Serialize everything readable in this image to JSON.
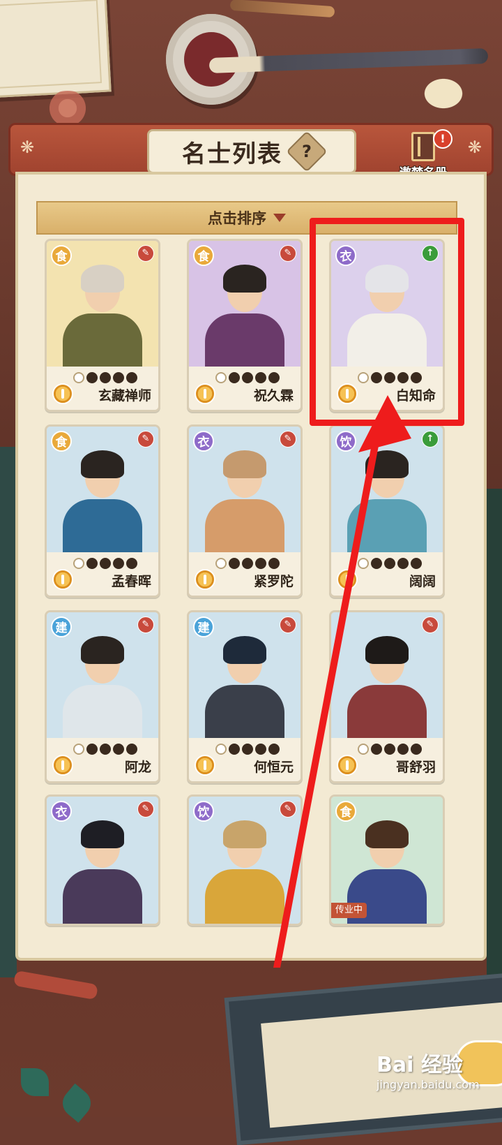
{
  "header": {
    "title": "名士列表",
    "help_symbol": "?",
    "album_label": "遨梦名册",
    "album_badge": "!"
  },
  "sort": {
    "label": "点击排序"
  },
  "cards": [
    {
      "name": "玄藏禅师",
      "category": "食",
      "category_color": "#e9a93a",
      "bg": "#f3e3b0",
      "corner": "✎",
      "corner_color": "#c84a3c",
      "hair": "#d8d0c4",
      "robe": "#6a6a3a",
      "stars_filled": 4
    },
    {
      "name": "祝久霖",
      "category": "食",
      "category_color": "#e9a93a",
      "bg": "#d8c3e6",
      "corner": "✎",
      "corner_color": "#c84a3c",
      "hair": "#2a2420",
      "robe": "#6a3a6a",
      "stars_filled": 4
    },
    {
      "name": "白知命",
      "category": "衣",
      "category_color": "#8e6bc9",
      "bg": "#dcd0ec",
      "corner": "↑",
      "corner_color": "#3a9c3a",
      "hair": "#e4e4e8",
      "robe": "#f2efe8",
      "stars_filled": 4
    },
    {
      "name": "孟春晖",
      "category": "食",
      "category_color": "#e9a93a",
      "bg": "#cfe2ec",
      "corner": "✎",
      "corner_color": "#c84a3c",
      "hair": "#2a2420",
      "robe": "#2e6b96",
      "stars_filled": 4
    },
    {
      "name": "紧罗陀",
      "category": "衣",
      "category_color": "#8e6bc9",
      "bg": "#cfe2ec",
      "corner": "✎",
      "corner_color": "#c84a3c",
      "hair": "#c59a6e",
      "robe": "#d69c6a",
      "stars_filled": 4
    },
    {
      "name": "阔阔",
      "category": "饮",
      "category_color": "#8e6bc9",
      "bg": "#cfe2ec",
      "corner": "↑",
      "corner_color": "#3a9c3a",
      "hair": "#2a2420",
      "robe": "#5aa0b4",
      "stars_filled": 4
    },
    {
      "name": "阿龙",
      "category": "建",
      "category_color": "#4aa3d9",
      "bg": "#cfe2ec",
      "corner": "✎",
      "corner_color": "#c84a3c",
      "hair": "#2a2420",
      "robe": "#dfe6ea",
      "stars_filled": 4
    },
    {
      "name": "何恒元",
      "category": "建",
      "category_color": "#4aa3d9",
      "bg": "#cfe2ec",
      "corner": "✎",
      "corner_color": "#c84a3c",
      "hair": "#1e2a3a",
      "robe": "#3a3f4a",
      "stars_filled": 4
    },
    {
      "name": "哥舒羽",
      "category": "",
      "category_color": "#4aa3d9",
      "bg": "#cfe2ec",
      "corner": "✎",
      "corner_color": "#c84a3c",
      "hair": "#1e1a18",
      "robe": "#8a3a3a",
      "stars_filled": 4
    },
    {
      "name": "",
      "category": "衣",
      "category_color": "#8e6bc9",
      "bg": "#cfe2ec",
      "corner": "✎",
      "corner_color": "#c84a3c",
      "hair": "#1e1e24",
      "robe": "#4a3a5a",
      "stars_filled": 4
    },
    {
      "name": "",
      "category": "饮",
      "category_color": "#8e6bc9",
      "bg": "#cfe2ec",
      "corner": "✎",
      "corner_color": "#c84a3c",
      "hair": "#c8a46a",
      "robe": "#d9a63a",
      "stars_filled": 4
    },
    {
      "name": "",
      "category": "食",
      "category_color": "#e9a93a",
      "bg": "#cfe6d4",
      "corner": "",
      "corner_color": "#c84a3c",
      "hair": "#4a3020",
      "robe": "#3a4a8a",
      "stars_filled": 4,
      "tag": "传业中"
    }
  ],
  "watermark": {
    "logo": "Bai 经验",
    "url": "jingyan.baidu.com"
  },
  "colors": {
    "highlight": "#ee1c1c",
    "panel_header": "#a8472f",
    "panel_body": "#f3ead3"
  }
}
